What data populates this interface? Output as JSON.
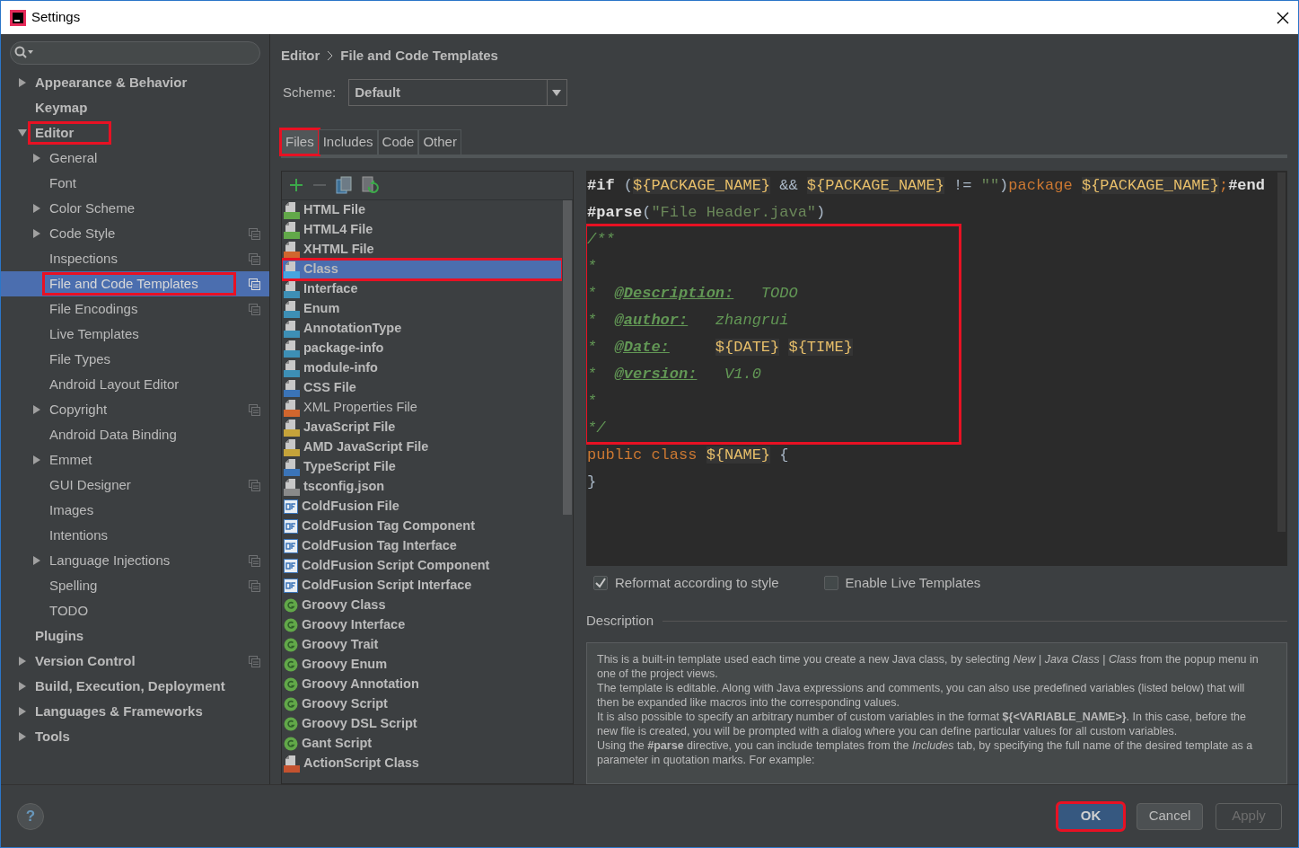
{
  "window": {
    "title": "Settings"
  },
  "sidebar": {
    "items": [
      {
        "label": "Appearance & Behavior",
        "kind": "folder",
        "expanded": false,
        "selected": false,
        "highlighted": false,
        "project_level": false
      },
      {
        "label": "Keymap",
        "kind": "leaf",
        "selected": false,
        "highlighted": false,
        "project_level": false
      },
      {
        "label": "Editor",
        "kind": "folder",
        "expanded": true,
        "selected": false,
        "highlighted": true,
        "project_level": false,
        "children": [
          {
            "label": "General",
            "kind": "folder",
            "expanded": false,
            "selected": false,
            "highlighted": false,
            "project_level": false
          },
          {
            "label": "Font",
            "kind": "leaf",
            "selected": false,
            "highlighted": false,
            "project_level": false
          },
          {
            "label": "Color Scheme",
            "kind": "folder",
            "expanded": false,
            "selected": false,
            "highlighted": false,
            "project_level": false
          },
          {
            "label": "Code Style",
            "kind": "folder",
            "expanded": false,
            "selected": false,
            "highlighted": false,
            "project_level": true
          },
          {
            "label": "Inspections",
            "kind": "leaf",
            "selected": false,
            "highlighted": false,
            "project_level": true
          },
          {
            "label": "File and Code Templates",
            "kind": "leaf",
            "selected": true,
            "highlighted": true,
            "project_level": true
          },
          {
            "label": "File Encodings",
            "kind": "leaf",
            "selected": false,
            "highlighted": false,
            "project_level": true
          },
          {
            "label": "Live Templates",
            "kind": "leaf",
            "selected": false,
            "highlighted": false,
            "project_level": false
          },
          {
            "label": "File Types",
            "kind": "leaf",
            "selected": false,
            "highlighted": false,
            "project_level": false
          },
          {
            "label": "Android Layout Editor",
            "kind": "leaf",
            "selected": false,
            "highlighted": false,
            "project_level": false
          },
          {
            "label": "Copyright",
            "kind": "folder",
            "expanded": false,
            "selected": false,
            "highlighted": false,
            "project_level": true
          },
          {
            "label": "Android Data Binding",
            "kind": "leaf",
            "selected": false,
            "highlighted": false,
            "project_level": false
          },
          {
            "label": "Emmet",
            "kind": "folder",
            "expanded": false,
            "selected": false,
            "highlighted": false,
            "project_level": false
          },
          {
            "label": "GUI Designer",
            "kind": "leaf",
            "selected": false,
            "highlighted": false,
            "project_level": true
          },
          {
            "label": "Images",
            "kind": "leaf",
            "selected": false,
            "highlighted": false,
            "project_level": false
          },
          {
            "label": "Intentions",
            "kind": "leaf",
            "selected": false,
            "highlighted": false,
            "project_level": false
          },
          {
            "label": "Language Injections",
            "kind": "folder",
            "expanded": false,
            "selected": false,
            "highlighted": false,
            "project_level": true
          },
          {
            "label": "Spelling",
            "kind": "leaf",
            "selected": false,
            "highlighted": false,
            "project_level": true
          },
          {
            "label": "TODO",
            "kind": "leaf",
            "selected": false,
            "highlighted": false,
            "project_level": false
          }
        ]
      },
      {
        "label": "Plugins",
        "kind": "leaf",
        "selected": false,
        "highlighted": false,
        "project_level": false
      },
      {
        "label": "Version Control",
        "kind": "folder",
        "expanded": false,
        "selected": false,
        "highlighted": false,
        "project_level": true
      },
      {
        "label": "Build, Execution, Deployment",
        "kind": "folder",
        "expanded": false,
        "selected": false,
        "highlighted": false,
        "project_level": false
      },
      {
        "label": "Languages & Frameworks",
        "kind": "folder",
        "expanded": false,
        "selected": false,
        "highlighted": false,
        "project_level": false
      },
      {
        "label": "Tools",
        "kind": "folder",
        "expanded": false,
        "selected": false,
        "highlighted": false,
        "project_level": false
      }
    ]
  },
  "breadcrumb": [
    "Editor",
    "File and Code Templates"
  ],
  "scheme": {
    "label": "Scheme:",
    "value": "Default"
  },
  "tabs": [
    {
      "label": "Files",
      "selected": true,
      "highlighted": true
    },
    {
      "label": "Includes",
      "selected": false,
      "highlighted": false
    },
    {
      "label": "Code",
      "selected": false,
      "highlighted": false
    },
    {
      "label": "Other",
      "selected": false,
      "highlighted": false
    }
  ],
  "templates": [
    {
      "label": "HTML File",
      "kind": "html",
      "bold": true,
      "selected": false,
      "highlighted": false
    },
    {
      "label": "HTML4 File",
      "kind": "html",
      "bold": true,
      "selected": false,
      "highlighted": false
    },
    {
      "label": "XHTML File",
      "kind": "xhtml",
      "bold": true,
      "selected": false,
      "highlighted": false
    },
    {
      "label": "Class",
      "kind": "java",
      "bold": true,
      "selected": true,
      "highlighted": true
    },
    {
      "label": "Interface",
      "kind": "java",
      "bold": true,
      "selected": false,
      "highlighted": false
    },
    {
      "label": "Enum",
      "kind": "java",
      "bold": true,
      "selected": false,
      "highlighted": false
    },
    {
      "label": "AnnotationType",
      "kind": "java",
      "bold": true,
      "selected": false,
      "highlighted": false
    },
    {
      "label": "package-info",
      "kind": "java",
      "bold": true,
      "selected": false,
      "highlighted": false
    },
    {
      "label": "module-info",
      "kind": "java",
      "bold": true,
      "selected": false,
      "highlighted": false
    },
    {
      "label": "CSS File",
      "kind": "css",
      "bold": true,
      "selected": false,
      "highlighted": false
    },
    {
      "label": "XML Properties File",
      "kind": "xml",
      "bold": false,
      "selected": false,
      "highlighted": false
    },
    {
      "label": "JavaScript File",
      "kind": "js",
      "bold": true,
      "selected": false,
      "highlighted": false
    },
    {
      "label": "AMD JavaScript File",
      "kind": "js",
      "bold": true,
      "selected": false,
      "highlighted": false
    },
    {
      "label": "TypeScript File",
      "kind": "ts",
      "bold": true,
      "selected": false,
      "highlighted": false
    },
    {
      "label": "tsconfig.json",
      "kind": "json",
      "bold": true,
      "selected": false,
      "highlighted": false
    },
    {
      "label": "ColdFusion File",
      "kind": "cf",
      "bold": true,
      "selected": false,
      "highlighted": false
    },
    {
      "label": "ColdFusion Tag Component",
      "kind": "cf",
      "bold": true,
      "selected": false,
      "highlighted": false
    },
    {
      "label": "ColdFusion Tag Interface",
      "kind": "cf",
      "bold": true,
      "selected": false,
      "highlighted": false
    },
    {
      "label": "ColdFusion Script Component",
      "kind": "cf",
      "bold": true,
      "selected": false,
      "highlighted": false
    },
    {
      "label": "ColdFusion Script Interface",
      "kind": "cf",
      "bold": true,
      "selected": false,
      "highlighted": false
    },
    {
      "label": "Groovy Class",
      "kind": "groovy",
      "bold": true,
      "selected": false,
      "highlighted": false
    },
    {
      "label": "Groovy Interface",
      "kind": "groovy",
      "bold": true,
      "selected": false,
      "highlighted": false
    },
    {
      "label": "Groovy Trait",
      "kind": "groovy",
      "bold": true,
      "selected": false,
      "highlighted": false
    },
    {
      "label": "Groovy Enum",
      "kind": "groovy",
      "bold": true,
      "selected": false,
      "highlighted": false
    },
    {
      "label": "Groovy Annotation",
      "kind": "groovy",
      "bold": true,
      "selected": false,
      "highlighted": false
    },
    {
      "label": "Groovy Script",
      "kind": "groovy",
      "bold": true,
      "selected": false,
      "highlighted": false
    },
    {
      "label": "Groovy DSL Script",
      "kind": "groovy",
      "bold": true,
      "selected": false,
      "highlighted": false
    },
    {
      "label": "Gant Script",
      "kind": "groovy",
      "bold": true,
      "selected": false,
      "highlighted": false
    },
    {
      "label": "ActionScript Class",
      "kind": "as",
      "bold": true,
      "selected": false,
      "highlighted": false
    }
  ],
  "editor": {
    "blocks": [
      {
        "highlighted": false,
        "lines": [
          [
            {
              "kind": "directive",
              "text": "#if"
            },
            {
              "kind": "plain",
              "text": " ("
            },
            {
              "kind": "var",
              "text": "${PACKAGE_NAME}"
            },
            {
              "kind": "plain",
              "text": " && "
            },
            {
              "kind": "var",
              "text": "${PACKAGE_NAME}"
            },
            {
              "kind": "plain",
              "text": " != "
            },
            {
              "kind": "string",
              "text": "\"\""
            },
            {
              "kind": "plain",
              "text": ")"
            },
            {
              "kind": "keyword",
              "text": "package "
            },
            {
              "kind": "var",
              "text": "${PACKAGE_NAME}"
            },
            {
              "kind": "keyword",
              "text": ";"
            },
            {
              "kind": "directive",
              "text": "#end"
            }
          ],
          [
            {
              "kind": "directive",
              "text": "#parse"
            },
            {
              "kind": "plain",
              "text": "("
            },
            {
              "kind": "string",
              "text": "\"File Header.java\""
            },
            {
              "kind": "plain",
              "text": ")"
            }
          ]
        ]
      },
      {
        "highlighted": true,
        "lines": [
          [
            {
              "kind": "comment",
              "text": "/**"
            }
          ],
          [
            {
              "kind": "comment",
              "text": "*"
            }
          ],
          [
            {
              "kind": "comment",
              "text": "*  "
            },
            {
              "kind": "tag",
              "text": "@Description:"
            },
            {
              "kind": "comment",
              "text": "   TODO"
            }
          ],
          [
            {
              "kind": "comment",
              "text": "*  "
            },
            {
              "kind": "tag",
              "text": "@author:"
            },
            {
              "kind": "comment",
              "text": "   zhangrui"
            }
          ],
          [
            {
              "kind": "comment",
              "text": "*  "
            },
            {
              "kind": "tag",
              "text": "@Date:"
            },
            {
              "kind": "var",
              "text": "     ${DATE}"
            },
            {
              "kind": "var",
              "text": " ${TIME}"
            }
          ],
          [
            {
              "kind": "comment",
              "text": "*  "
            },
            {
              "kind": "tag",
              "text": "@version:"
            },
            {
              "kind": "comment",
              "text": "   V1.0"
            }
          ],
          [
            {
              "kind": "comment",
              "text": "*"
            }
          ],
          [
            {
              "kind": "comment",
              "text": "*/"
            }
          ]
        ]
      },
      {
        "highlighted": false,
        "lines": [
          [
            {
              "kind": "keyword",
              "text": "public class "
            },
            {
              "kind": "var",
              "text": "${NAME}"
            },
            {
              "kind": "plain",
              "text": " {"
            }
          ],
          [
            {
              "kind": "plain",
              "text": "}"
            }
          ]
        ]
      }
    ]
  },
  "options": [
    {
      "label": "Reformat according to style",
      "checked": true
    },
    {
      "label": "Enable Live Templates",
      "checked": false
    }
  ],
  "description": {
    "title": "Description",
    "paragraphs": [
      "This is a built-in template used each time you create a new Java class, by selecting *New* | *Java Class* | *Class* from the popup menu in one of the project views.",
      "The template is editable. Along with Java expressions and comments, you can also use predefined variables (listed below) that will then be expanded like macros into the corresponding values.",
      "It is also possible to specify an arbitrary number of custom variables in the format **${<VARIABLE_NAME>}**. In this case, before the new file is created, you will be prompted with a dialog where you can define particular values for all custom variables.",
      "Using the **#parse** directive, you can include templates from the *Includes* tab, by specifying the full name of the desired template as a parameter in quotation marks. For example:"
    ]
  },
  "help": "?",
  "buttons": [
    {
      "label": "OK",
      "kind": "default",
      "highlighted": true,
      "disabled": false
    },
    {
      "label": "Cancel",
      "kind": "normal",
      "highlighted": false,
      "disabled": false
    },
    {
      "label": "Apply",
      "kind": "normal",
      "highlighted": false,
      "disabled": true
    }
  ]
}
